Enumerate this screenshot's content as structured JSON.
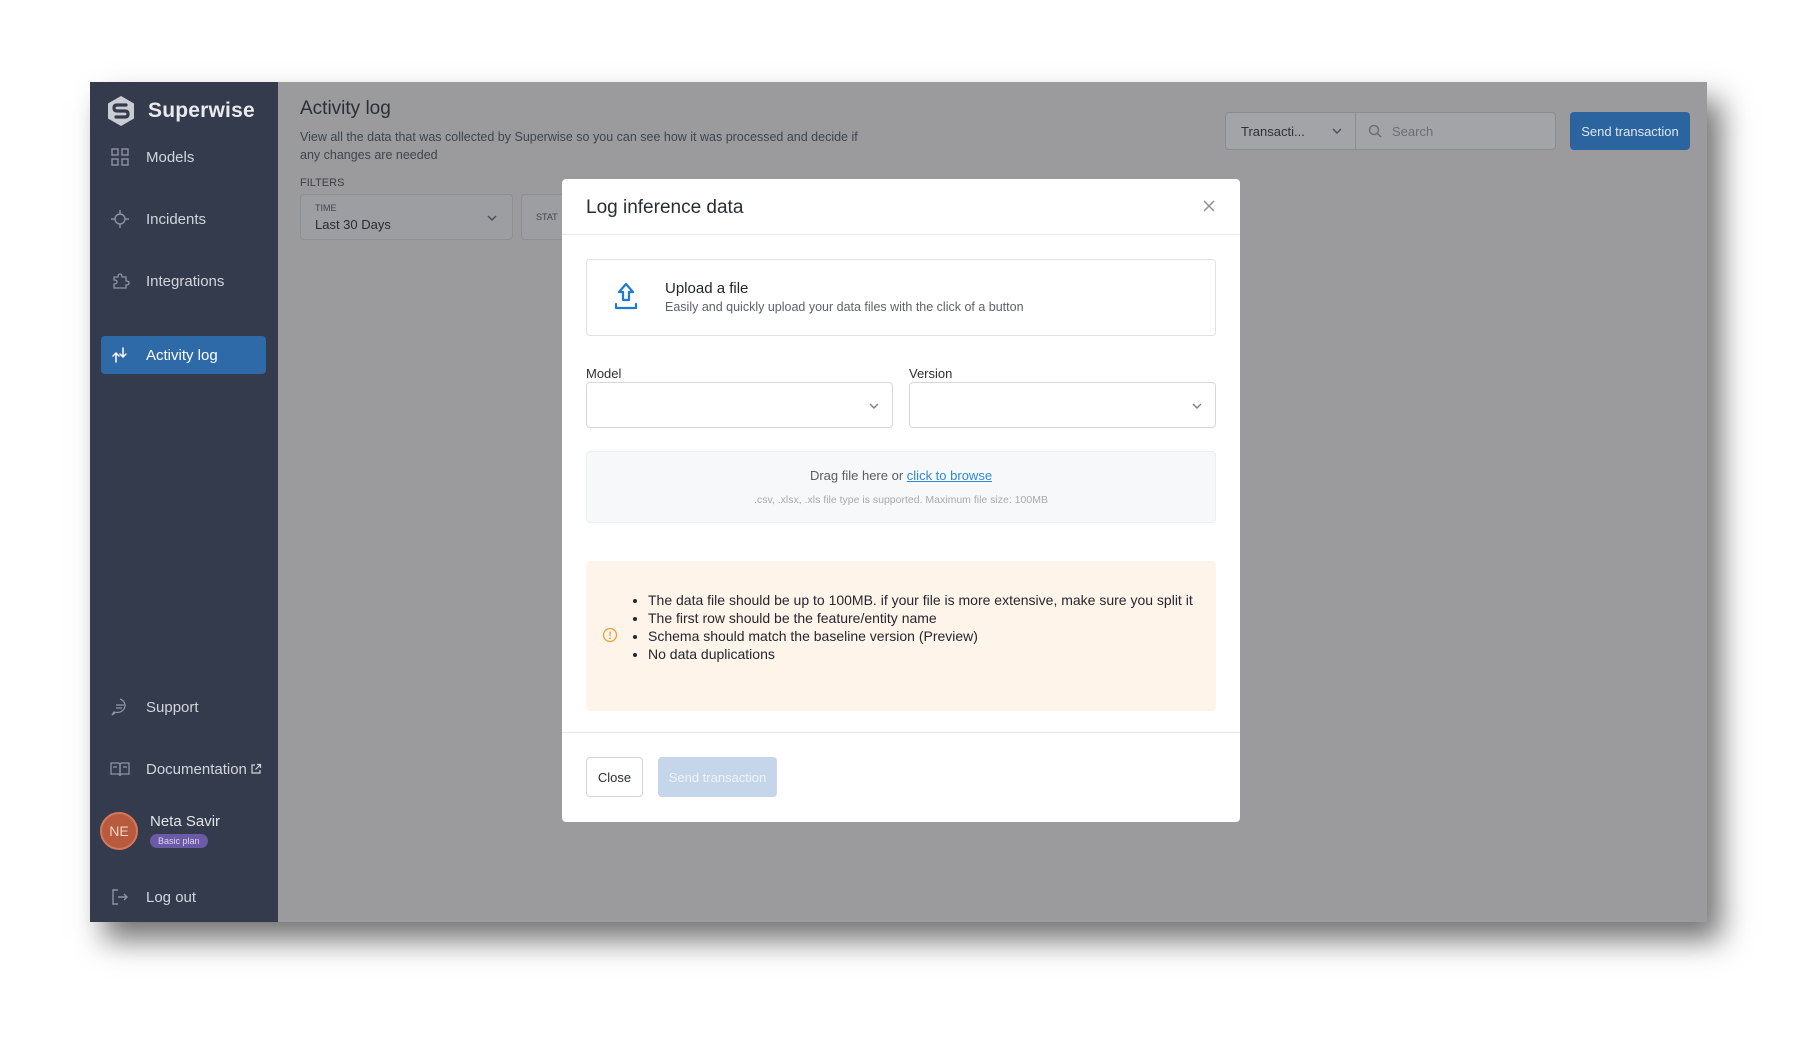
{
  "brand": {
    "name": "Superwise"
  },
  "sidebar": {
    "items": [
      {
        "label": "Models",
        "icon": "grid-icon"
      },
      {
        "label": "Incidents",
        "icon": "crosshair-icon"
      },
      {
        "label": "Integrations",
        "icon": "puzzle-icon"
      },
      {
        "label": "Activity log",
        "icon": "arrows-icon",
        "active": true
      }
    ],
    "bottom": [
      {
        "label": "Support",
        "icon": "chat-icon"
      },
      {
        "label": "Documentation",
        "icon": "book-icon"
      }
    ],
    "user": {
      "initials": "NE",
      "name": "Neta Savir",
      "plan": "Basic plan"
    },
    "logout": "Log out"
  },
  "page": {
    "title": "Activity log",
    "description": "View all the data that was collected by Superwise so you can see how it was processed and decide if any changes are needed",
    "filters_label": "FILTERS",
    "filter_time_label": "TIME",
    "filter_time_value": "Last 30 Days",
    "filter_status_label": "STAT",
    "type_select": "Transacti...",
    "search_placeholder": "Search",
    "send_button": "Send transaction"
  },
  "modal": {
    "title": "Log inference data",
    "upload_title": "Upload a file",
    "upload_subtitle": "Easily and quickly upload your data files with the click of a button",
    "model_label": "Model",
    "version_label": "Version",
    "drop_text": "Drag file here or",
    "drop_link": "click to browse",
    "drop_hint": ".csv, .xlsx, .xls file type is supported. Maximum file size: 100MB",
    "notes": [
      "The data file should be up to 100MB. if your file is more extensive, make sure you split it",
      "The first row should be the feature/entity name",
      "Schema should match the baseline version (Preview)",
      "No data duplications"
    ],
    "close_button": "Close",
    "send_button": "Send transaction"
  },
  "colors": {
    "sidebar_bg": "#343b4d",
    "active_nav": "#2f6aa8",
    "primary": "#2c64a0",
    "link": "#2f88d6",
    "notice_bg": "#fff4ea",
    "warning": "#e3a13b"
  }
}
